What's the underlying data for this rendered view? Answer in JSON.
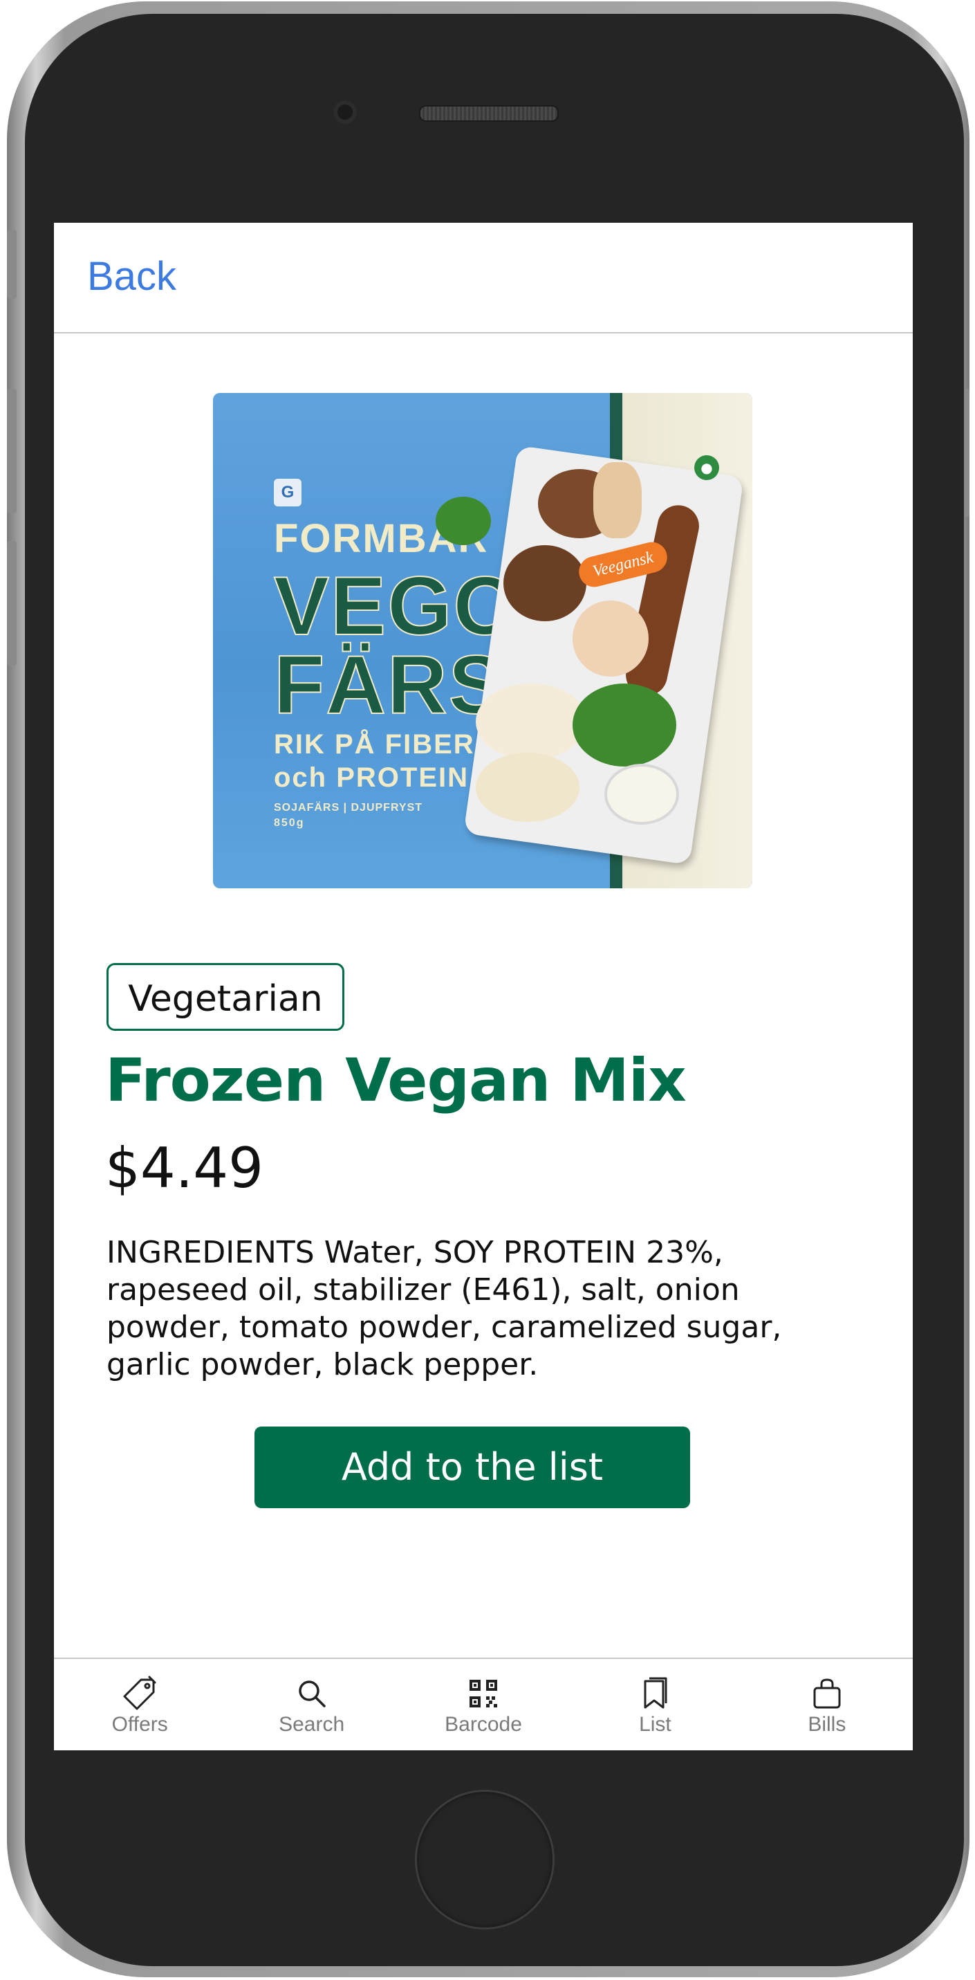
{
  "nav": {
    "back_label": "Back"
  },
  "product_image": {
    "brand_logo": "G",
    "line_1": "FORMBAR",
    "line_2": "VEGO",
    "line_3": "FÄRS",
    "line_4": "RIK PÅ FIBER",
    "line_5": "och PROTEIN",
    "line_6": "SOJAFÄRS | DJUPFRYST",
    "line_7": "850g",
    "tag": "Veegansk"
  },
  "product": {
    "badge": "Vegetarian",
    "title": "Frozen Vegan Mix",
    "price": "$4.49",
    "ingredients": "INGREDIENTS Water, SOY PROTEIN 23%, rapeseed oil, stabilizer (E461), salt, onion powder, tomato powder, caramelized sugar, garlic powder, black pepper."
  },
  "actions": {
    "add_label": "Add to the list"
  },
  "tab_bar": {
    "items": [
      {
        "label": "Offers",
        "icon": "tag-icon"
      },
      {
        "label": "Search",
        "icon": "search-icon"
      },
      {
        "label": "Barcode",
        "icon": "qr-code-icon"
      },
      {
        "label": "List",
        "icon": "bookmark-icon"
      },
      {
        "label": "Bills",
        "icon": "bag-icon"
      }
    ]
  },
  "colors": {
    "accent_green": "#006d4b",
    "link_blue": "#3d7be0",
    "tab_gray": "#7a7a7a"
  }
}
